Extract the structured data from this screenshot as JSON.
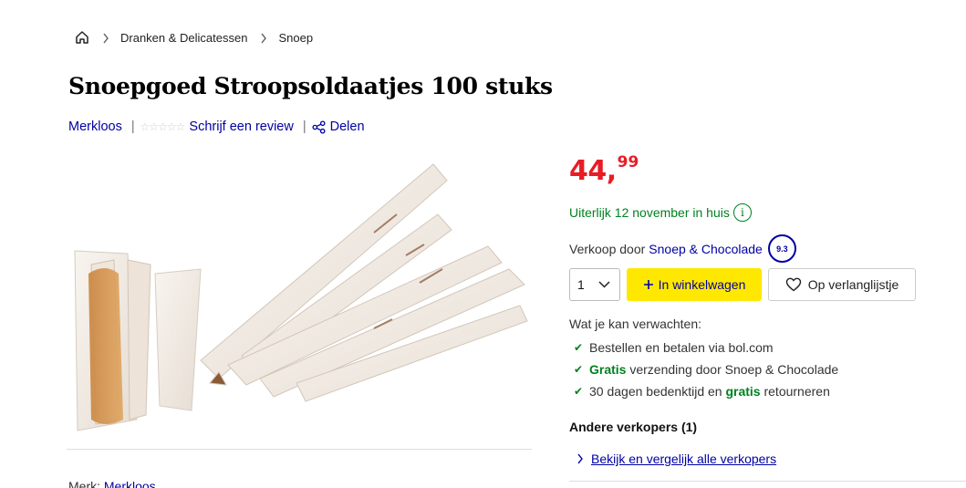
{
  "breadcrumb": {
    "home_icon": "home-icon",
    "items": [
      "Dranken & Delicatessen",
      "Snoep"
    ]
  },
  "product": {
    "title": "Snoepgoed Stroopsoldaatjes 100 stuks",
    "brand": "Merkloos",
    "review_link": "Schrijf een review",
    "share_label": "Delen",
    "rating_stars": "☆☆☆☆☆"
  },
  "price": {
    "integer": "44,",
    "cents": "99",
    "color": "#e81c25"
  },
  "delivery": {
    "text": "Uiterlijk 12 november in huis",
    "info_glyph": "i",
    "color": "#00811f"
  },
  "seller": {
    "prefix": "Verkoop door",
    "name": "Snoep & Chocolade",
    "rating": "9.3"
  },
  "actions": {
    "quantity": "1",
    "cart_label": "In winkelwagen",
    "wishlist_label": "Op verlanglijstje",
    "cart_color": "#ffe800"
  },
  "expect": {
    "heading": "Wat je kan verwachten:",
    "item1": "Bestellen en betalen via bol.com",
    "item2_bold": "Gratis",
    "item2_rest": " verzending door Snoep & Chocolade",
    "item3_pre": "30 dagen bedenktijd en ",
    "item3_bold": "gratis",
    "item3_post": " retourneren"
  },
  "other_sellers": {
    "heading": "Andere verkopers (1)",
    "link": "Bekijk en vergelijk alle verkopers"
  },
  "brand_line": {
    "label": "Merk: ",
    "value": "Merkloos"
  }
}
